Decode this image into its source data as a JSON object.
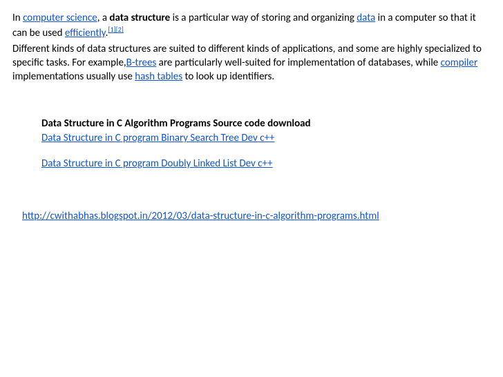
{
  "intro": {
    "part1": "In ",
    "link1": "computer science",
    "part2": ", a ",
    "bold1": "data structure",
    "part3": " is a particular way of storing and organizing ",
    "link2": "data",
    "part4": " in a computer so that it can be used ",
    "link3": "efficiently",
    "period": ".",
    "ref1": "[1]",
    "ref2": "[2]"
  },
  "para2": {
    "part1": "Different kinds of data structures are suited to different kinds of applications, and some are highly specialized to specific tasks. For example,",
    "link1": "B-trees",
    "part2": " are particularly well-suited for implementation of databases, while ",
    "link2": "compiler",
    "part3": " implementations usually use ",
    "link3": "hash tables",
    "part4": " to look up identifiers."
  },
  "heading": "Data Structure in C Algorithm Programs Source code download",
  "links": {
    "item1": "Data Structure in C program Binary Search Tree Dev c++",
    "item2": "Data Structure in C program Doubly Linked List Dev c++"
  },
  "footer": "http://cwithabhas.blogspot.in/2012/03/data-structure-in-c-algorithm-programs.html"
}
